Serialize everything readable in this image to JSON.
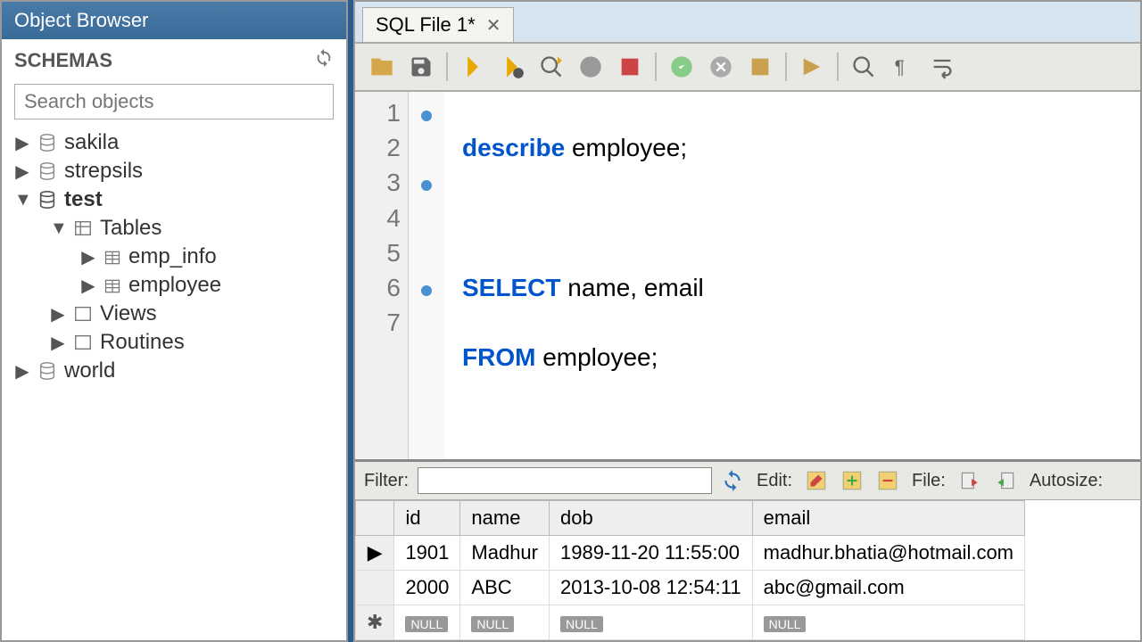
{
  "panel": {
    "title": "Object Browser",
    "schemas_label": "SCHEMAS",
    "search_placeholder": "Search objects"
  },
  "tree": {
    "sakila": "sakila",
    "strepsils": "strepsils",
    "test": "test",
    "tables": "Tables",
    "emp_info": "emp_info",
    "employee": "employee",
    "views": "Views",
    "routines": "Routines",
    "world": "world"
  },
  "tab": {
    "label": "SQL File 1*"
  },
  "code": {
    "line1": "describe employee;",
    "line3a": "SELECT",
    "line3b": " name, email",
    "line4a": "FROM",
    "line4b": " employee;",
    "line6a": "SELECT",
    "line6b": " *",
    "line7a": "FROM",
    "line7b": " employee;"
  },
  "results": {
    "filter_label": "Filter:",
    "edit_label": "Edit:",
    "file_label": "File:",
    "autosize_label": "Autosize:",
    "columns": {
      "id": "id",
      "name": "name",
      "dob": "dob",
      "email": "email"
    },
    "rows": [
      {
        "id": "1901",
        "name": "Madhur",
        "dob": "1989-11-20 11:55:00",
        "email": "madhur.bhatia@hotmail.com"
      },
      {
        "id": "2000",
        "name": "ABC",
        "dob": "2013-10-08 12:54:11",
        "email": "abc@gmail.com"
      }
    ],
    "null": "NULL"
  }
}
